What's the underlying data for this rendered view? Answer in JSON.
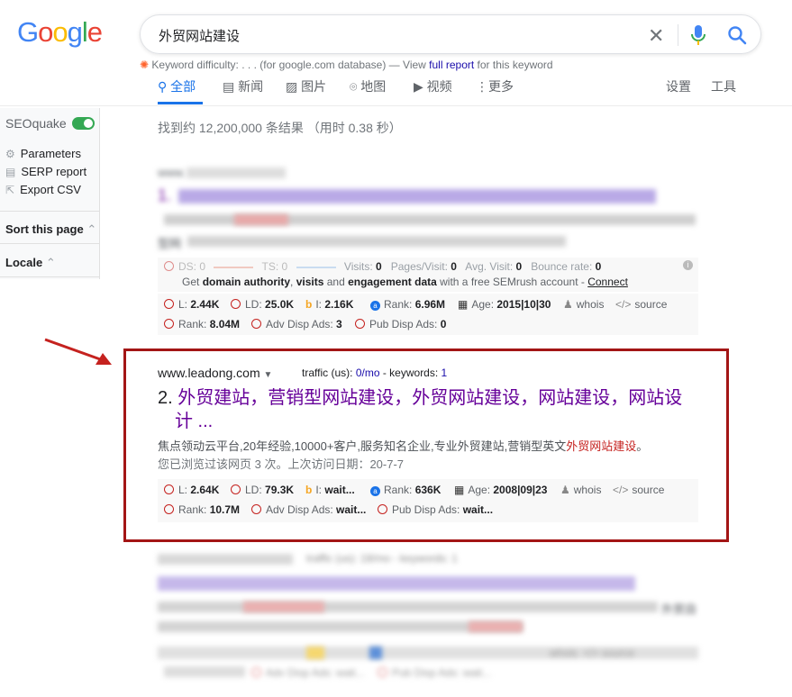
{
  "logo": {
    "letters": [
      "G",
      "o",
      "o",
      "g",
      "l",
      "e"
    ],
    "colors": [
      "#4285f4",
      "#ea4335",
      "#fbbc05",
      "#4285f4",
      "#34a853",
      "#ea4335"
    ]
  },
  "search": {
    "query": "外贸网站建设"
  },
  "keyword_difficulty": {
    "label": "Keyword difficulty:",
    "value": ". . .",
    "db_note": "(for google.com database) —",
    "view": "View",
    "link": "full report",
    "suffix": "for this keyword"
  },
  "tabs": [
    {
      "label": "全部",
      "icon": "search-icon"
    },
    {
      "label": "新闻",
      "icon": "news-icon"
    },
    {
      "label": "图片",
      "icon": "image-icon"
    },
    {
      "label": "地图",
      "icon": "map-pin-icon"
    },
    {
      "label": "视频",
      "icon": "video-icon"
    },
    {
      "label": "更多",
      "icon": "more-vertical-icon"
    }
  ],
  "tools": {
    "settings": "设置",
    "tools": "工具"
  },
  "sidebar": {
    "title": "SEOquake",
    "items": [
      {
        "label": "Parameters",
        "icon": "gear-icon"
      },
      {
        "label": "SERP report",
        "icon": "report-icon"
      },
      {
        "label": "Export CSV",
        "icon": "export-icon"
      }
    ],
    "sort": "Sort this page",
    "locale": "Locale"
  },
  "stats": "找到约 12,200,000 条结果 （用时 0.38 秒）",
  "result1": {
    "url_partial": "www.",
    "title_prefix": "1.",
    "bottom_partial": "型网",
    "stats_row": {
      "ds": "DS:",
      "ds_v": "0",
      "ts": "TS:",
      "ts_v": "0",
      "visits": "Visits:",
      "visits_v": "0",
      "ppv": "Pages/Visit:",
      "ppv_v": "0",
      "avg": "Avg. Visit:",
      "avg_v": "0",
      "bounce": "Bounce rate:",
      "bounce_v": "0"
    },
    "promo": {
      "pre": "Get ",
      "b1": "domain authority",
      "c1": ", ",
      "b2": "visits",
      "c2": " and ",
      "b3": "engagement data",
      "post": " with a free SEMrush account - ",
      "link": "Connect"
    },
    "metrics1": [
      {
        "label": "L:",
        "value": "2.44K"
      },
      {
        "label": "LD:",
        "value": "25.0K"
      },
      {
        "label": "I:",
        "value": "2.16K"
      },
      {
        "label": "Rank:",
        "value": "6.96M"
      },
      {
        "label": "Age:",
        "value": "2015|10|30"
      },
      {
        "label": "whois"
      },
      {
        "label": "source"
      }
    ],
    "metrics2": [
      {
        "label": "Rank:",
        "value": "8.04M"
      },
      {
        "label": "Adv Disp Ads:",
        "value": "3"
      },
      {
        "label": "Pub Disp Ads:",
        "value": "0"
      }
    ]
  },
  "result2": {
    "url": "www.leadong.com",
    "traffic_label": "traffic (us):",
    "traffic_value": "0/mo",
    "keywords_label": "- keywords:",
    "keywords_value": "1",
    "number": "2.",
    "title_line1": "外贸建站，营销型网站建设，外贸网站建设，网站建设，网站设",
    "title_line2": "计 ...",
    "snippet_pre": "焦点领动云平台,20年经验,10000+客户,服务知名企业,专业外贸建站,营销型英文",
    "snippet_hl": "外贸网站建设",
    "snippet_post": "。",
    "visited": "您已浏览过该网页 3 次。上次访问日期：20-7-7",
    "metrics1": [
      {
        "label": "L:",
        "value": "2.64K"
      },
      {
        "label": "LD:",
        "value": "79.3K"
      },
      {
        "label": "I:",
        "value": "wait..."
      },
      {
        "label": "Rank:",
        "value": "636K"
      },
      {
        "label": "Age:",
        "value": "2008|09|23"
      },
      {
        "label": "whois"
      },
      {
        "label": "source"
      }
    ],
    "metrics2": [
      {
        "label": "Rank:",
        "value": "10.7M"
      },
      {
        "label": "Adv Disp Ads:",
        "value": "wait..."
      },
      {
        "label": "Pub Disp Ads:",
        "value": "wait..."
      }
    ]
  },
  "result3": {
    "traffic": "traffic (us): 18/mo - keywords: 1",
    "tail": "外贸自",
    "whois": "whois",
    "source": "source",
    "adv": "Adv Disp Ads: wait...",
    "pub": "Pub Disp Ads: wait..."
  }
}
